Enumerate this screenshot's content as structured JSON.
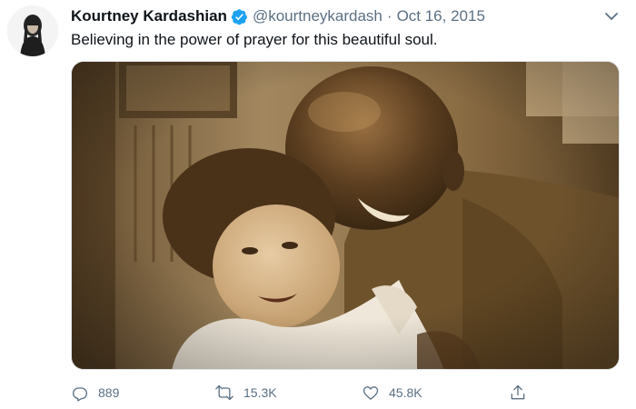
{
  "tweet": {
    "author": {
      "display_name": "Kourtney Kardashian",
      "handle": "@kourtneykardash",
      "verified": true
    },
    "separator": "·",
    "date": "Oct 16, 2015",
    "text": "Believing in the power of prayer for this beautiful soul.",
    "stats": {
      "replies": "889",
      "retweets": "15.3K",
      "likes": "45.8K"
    }
  },
  "icons": {
    "verified": "verified-badge-icon",
    "caret": "chevron-down-icon",
    "reply": "reply-icon",
    "retweet": "retweet-icon",
    "like": "heart-icon",
    "share": "share-icon"
  },
  "colors": {
    "text_primary": "#0f1419",
    "text_secondary": "#5b7083",
    "verified_blue": "#1da1f2",
    "photo_sepia": "#8a6a3e"
  }
}
